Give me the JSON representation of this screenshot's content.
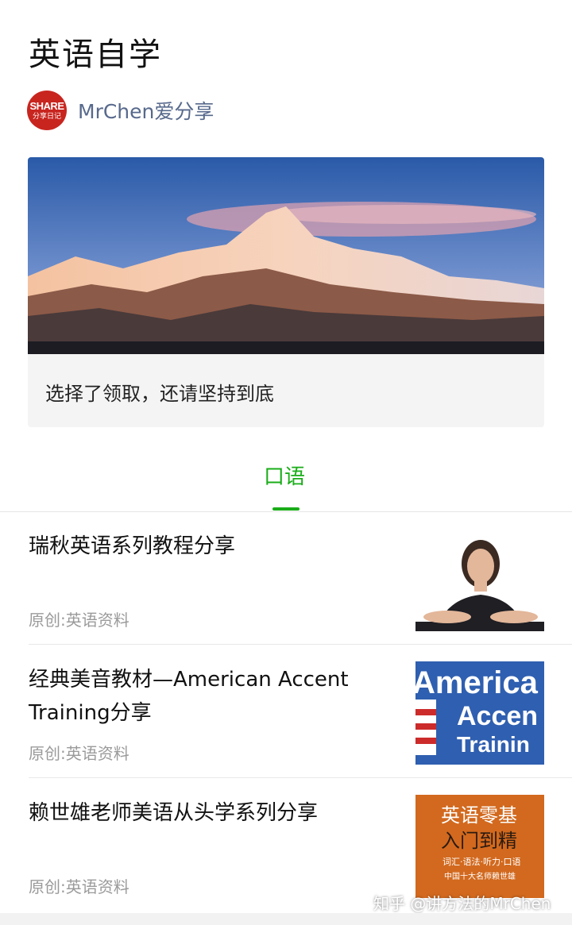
{
  "header": {
    "title": "英语自学"
  },
  "author": {
    "avatar_line1": "SHARE",
    "avatar_line2": "分享日记",
    "name": "MrChen爱分享"
  },
  "banner": {
    "caption": "选择了领取，还请坚持到底"
  },
  "tabs": [
    {
      "label": "口语",
      "active": true
    }
  ],
  "articles": [
    {
      "title": "瑞秋英语系列教程分享",
      "source": "原创:英语资料"
    },
    {
      "title": "经典美音教材—American Accent Training分享",
      "source": "原创:英语资料",
      "thumb_text": [
        "America",
        "Accen",
        "Trainin"
      ]
    },
    {
      "title": "赖世雄老师美语从头学系列分享",
      "source": "原创:英语资料",
      "thumb_text": [
        "英语零基",
        "入门到精",
        "词汇·语法·听力·口语",
        "中国十大名师赖世雄"
      ]
    }
  ],
  "watermark": "知乎 @讲方法的MrChen",
  "colors": {
    "accent": "#1aad19",
    "author": "#57698c",
    "muted": "#9a9a9a",
    "avatar_bg": "#c8251f"
  },
  "icons": [
    "avatar-logo"
  ]
}
